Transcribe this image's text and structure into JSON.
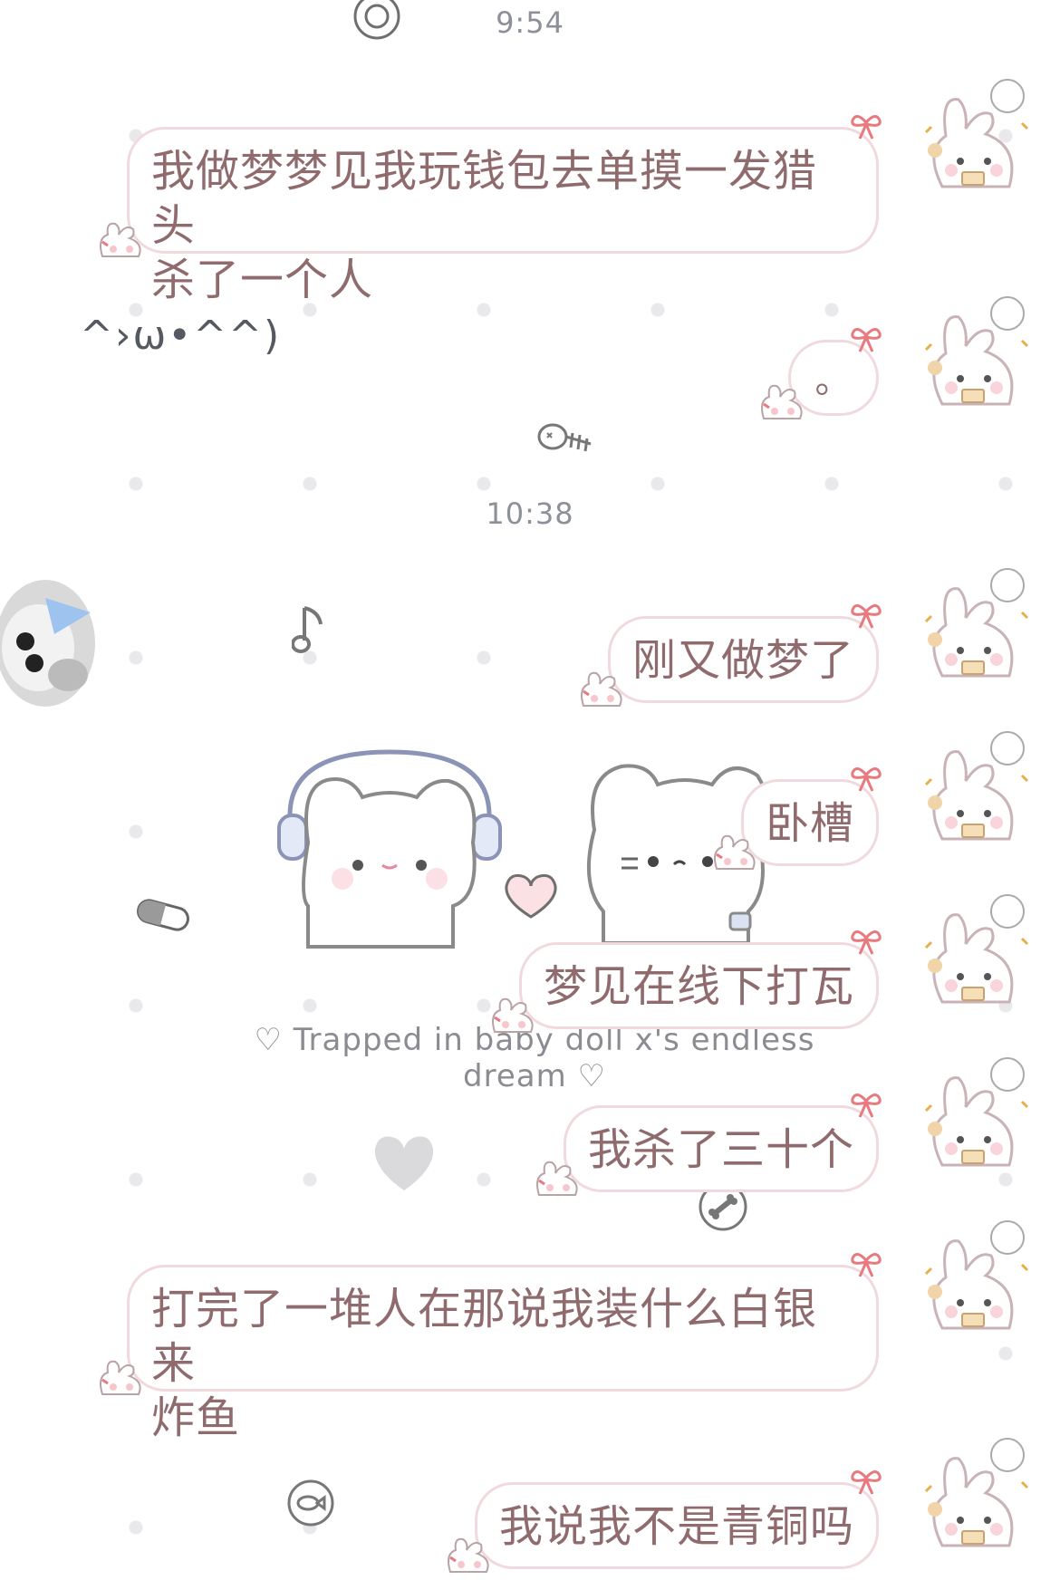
{
  "chat": {
    "timestamps": [
      "9:54",
      "10:38"
    ],
    "kaomoji": "^›ω•^^)",
    "caption": "♡ Trapped in baby doll x's endless dream ♡",
    "messages": [
      {
        "sender": "me",
        "text": "我做梦梦见我玩钱包去单摸一发猎头\n杀了一个人"
      },
      {
        "sender": "me",
        "text": "。"
      },
      {
        "sender": "me",
        "text": "刚又做梦了"
      },
      {
        "sender": "me",
        "text": "卧槽"
      },
      {
        "sender": "me",
        "text": "梦见在线下打瓦"
      },
      {
        "sender": "me",
        "text": "我杀了三十个"
      },
      {
        "sender": "me",
        "text": "打完了一堆人在那说我装什么白银来\n炸鱼"
      },
      {
        "sender": "me",
        "text": "我说我不是青铜吗"
      }
    ]
  },
  "theme": {
    "bubble_border": "#f1dadd",
    "bubble_text": "#8f6b6e",
    "timestamp_color": "#8d8f99",
    "bow_color": "#e8797f"
  },
  "icons": [
    "bow-icon",
    "bunny-sticker-icon",
    "bunny-avatar-icon",
    "dog-avatar-icon",
    "fishbone-icon",
    "music-note-icon",
    "pill-icon",
    "heart-icon",
    "bone-icon",
    "fish-icon"
  ]
}
